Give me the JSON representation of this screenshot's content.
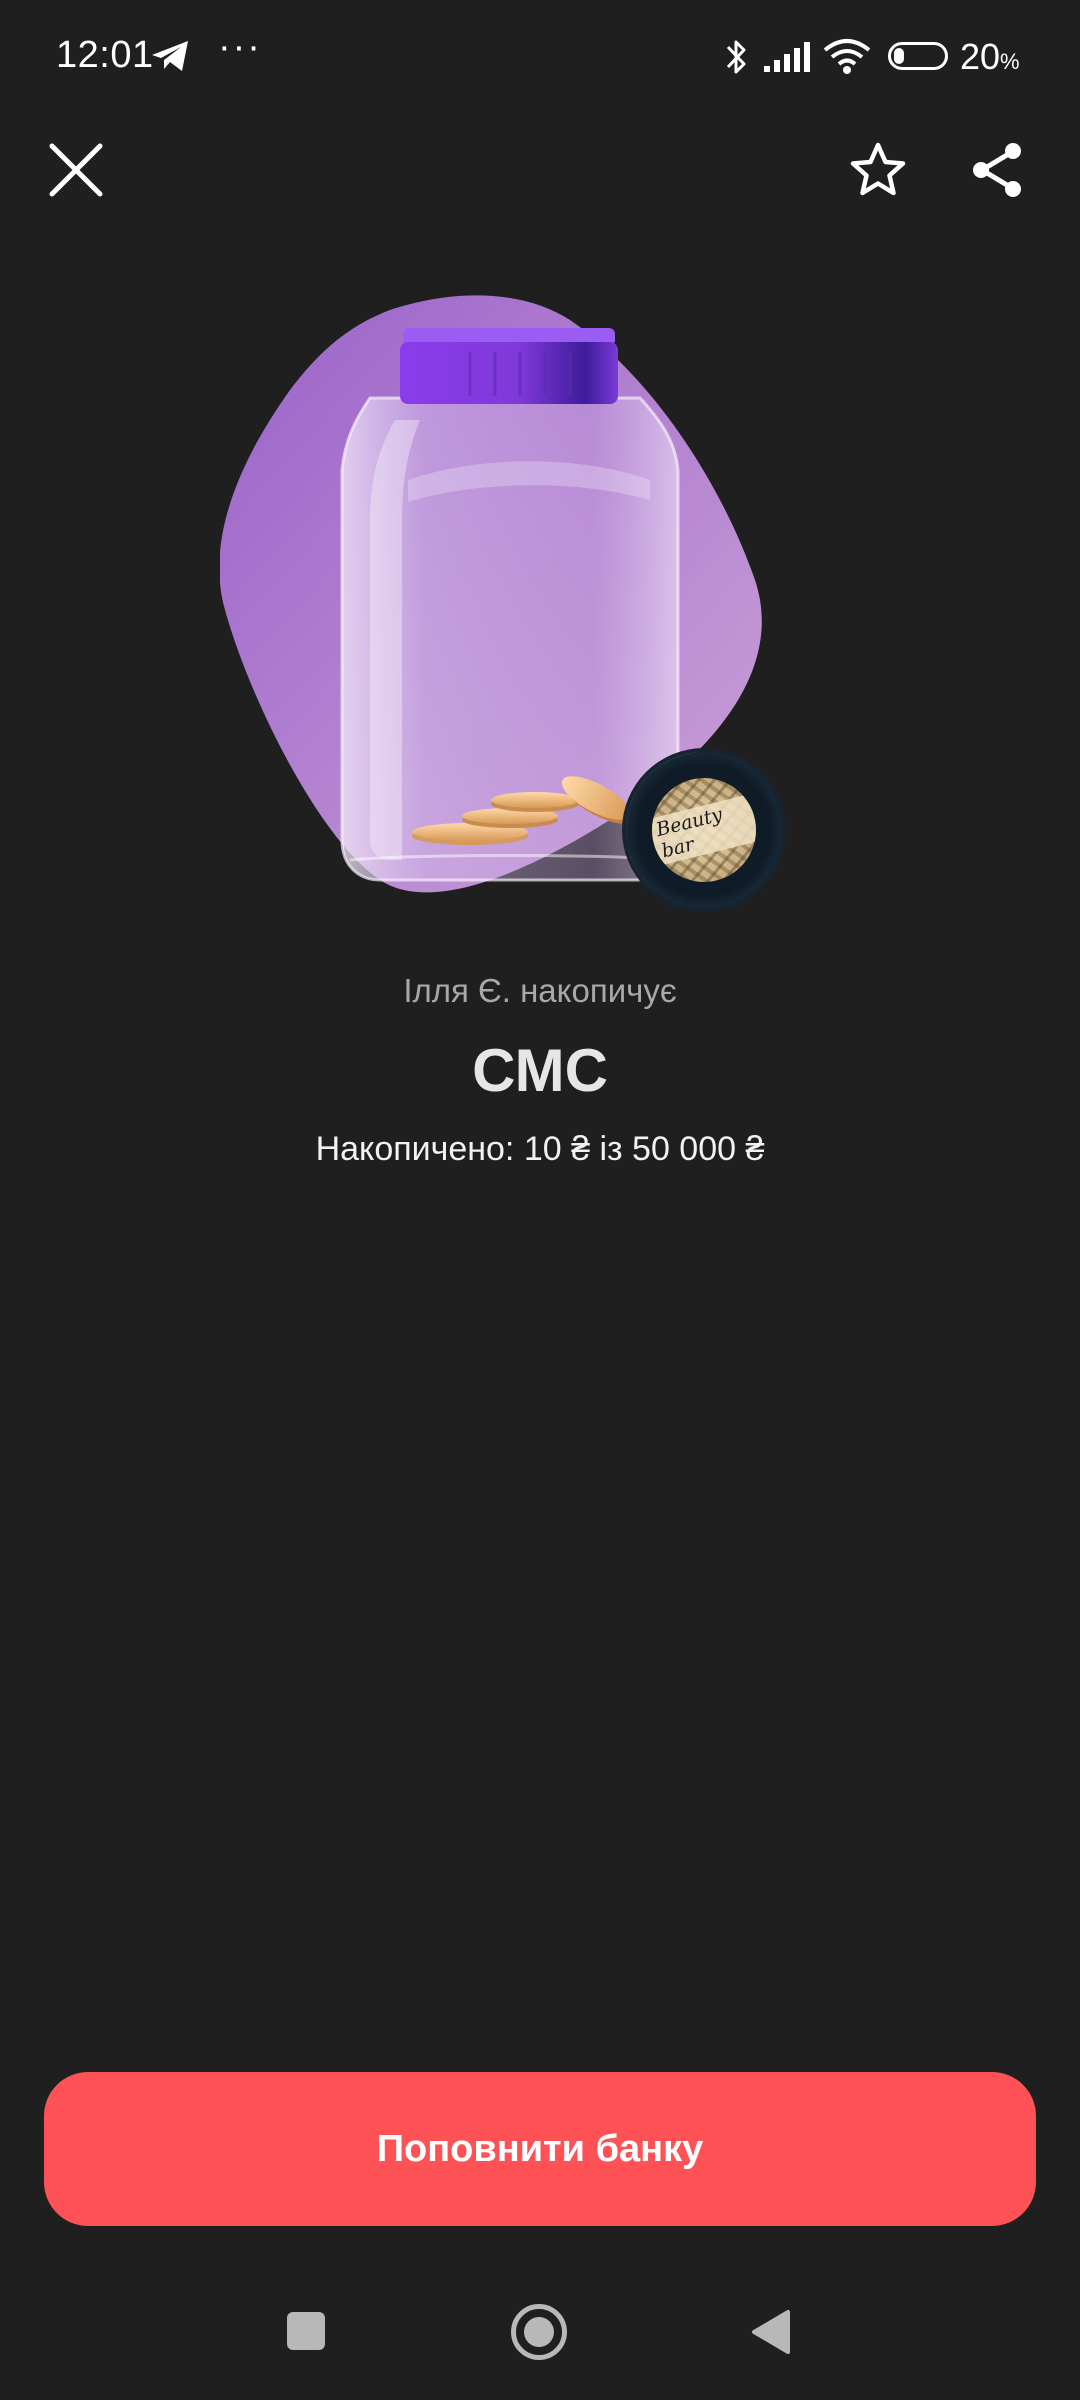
{
  "status_bar": {
    "time": "12:01",
    "dots": "···",
    "battery_value": "20",
    "battery_unit": "%",
    "battery_level": 0.2
  },
  "top_actions": {
    "close_icon": "close-icon",
    "favorite_icon": "star-icon",
    "share_icon": "share-icon"
  },
  "jar": {
    "owner_line": "Ілля Є. накопичує",
    "title": "СМС",
    "progress_text": "Накопичено: 10 ₴ із 50 000 ₴",
    "collected": 10,
    "goal": 50000,
    "currency": "₴",
    "avatar_text": "Beauty bar"
  },
  "cta": {
    "label": "Поповнити банку"
  },
  "colors": {
    "background": "#1f1f1f",
    "accent": "#ff5257",
    "blob": "#b07fd0",
    "lid": "#7b35d6"
  }
}
